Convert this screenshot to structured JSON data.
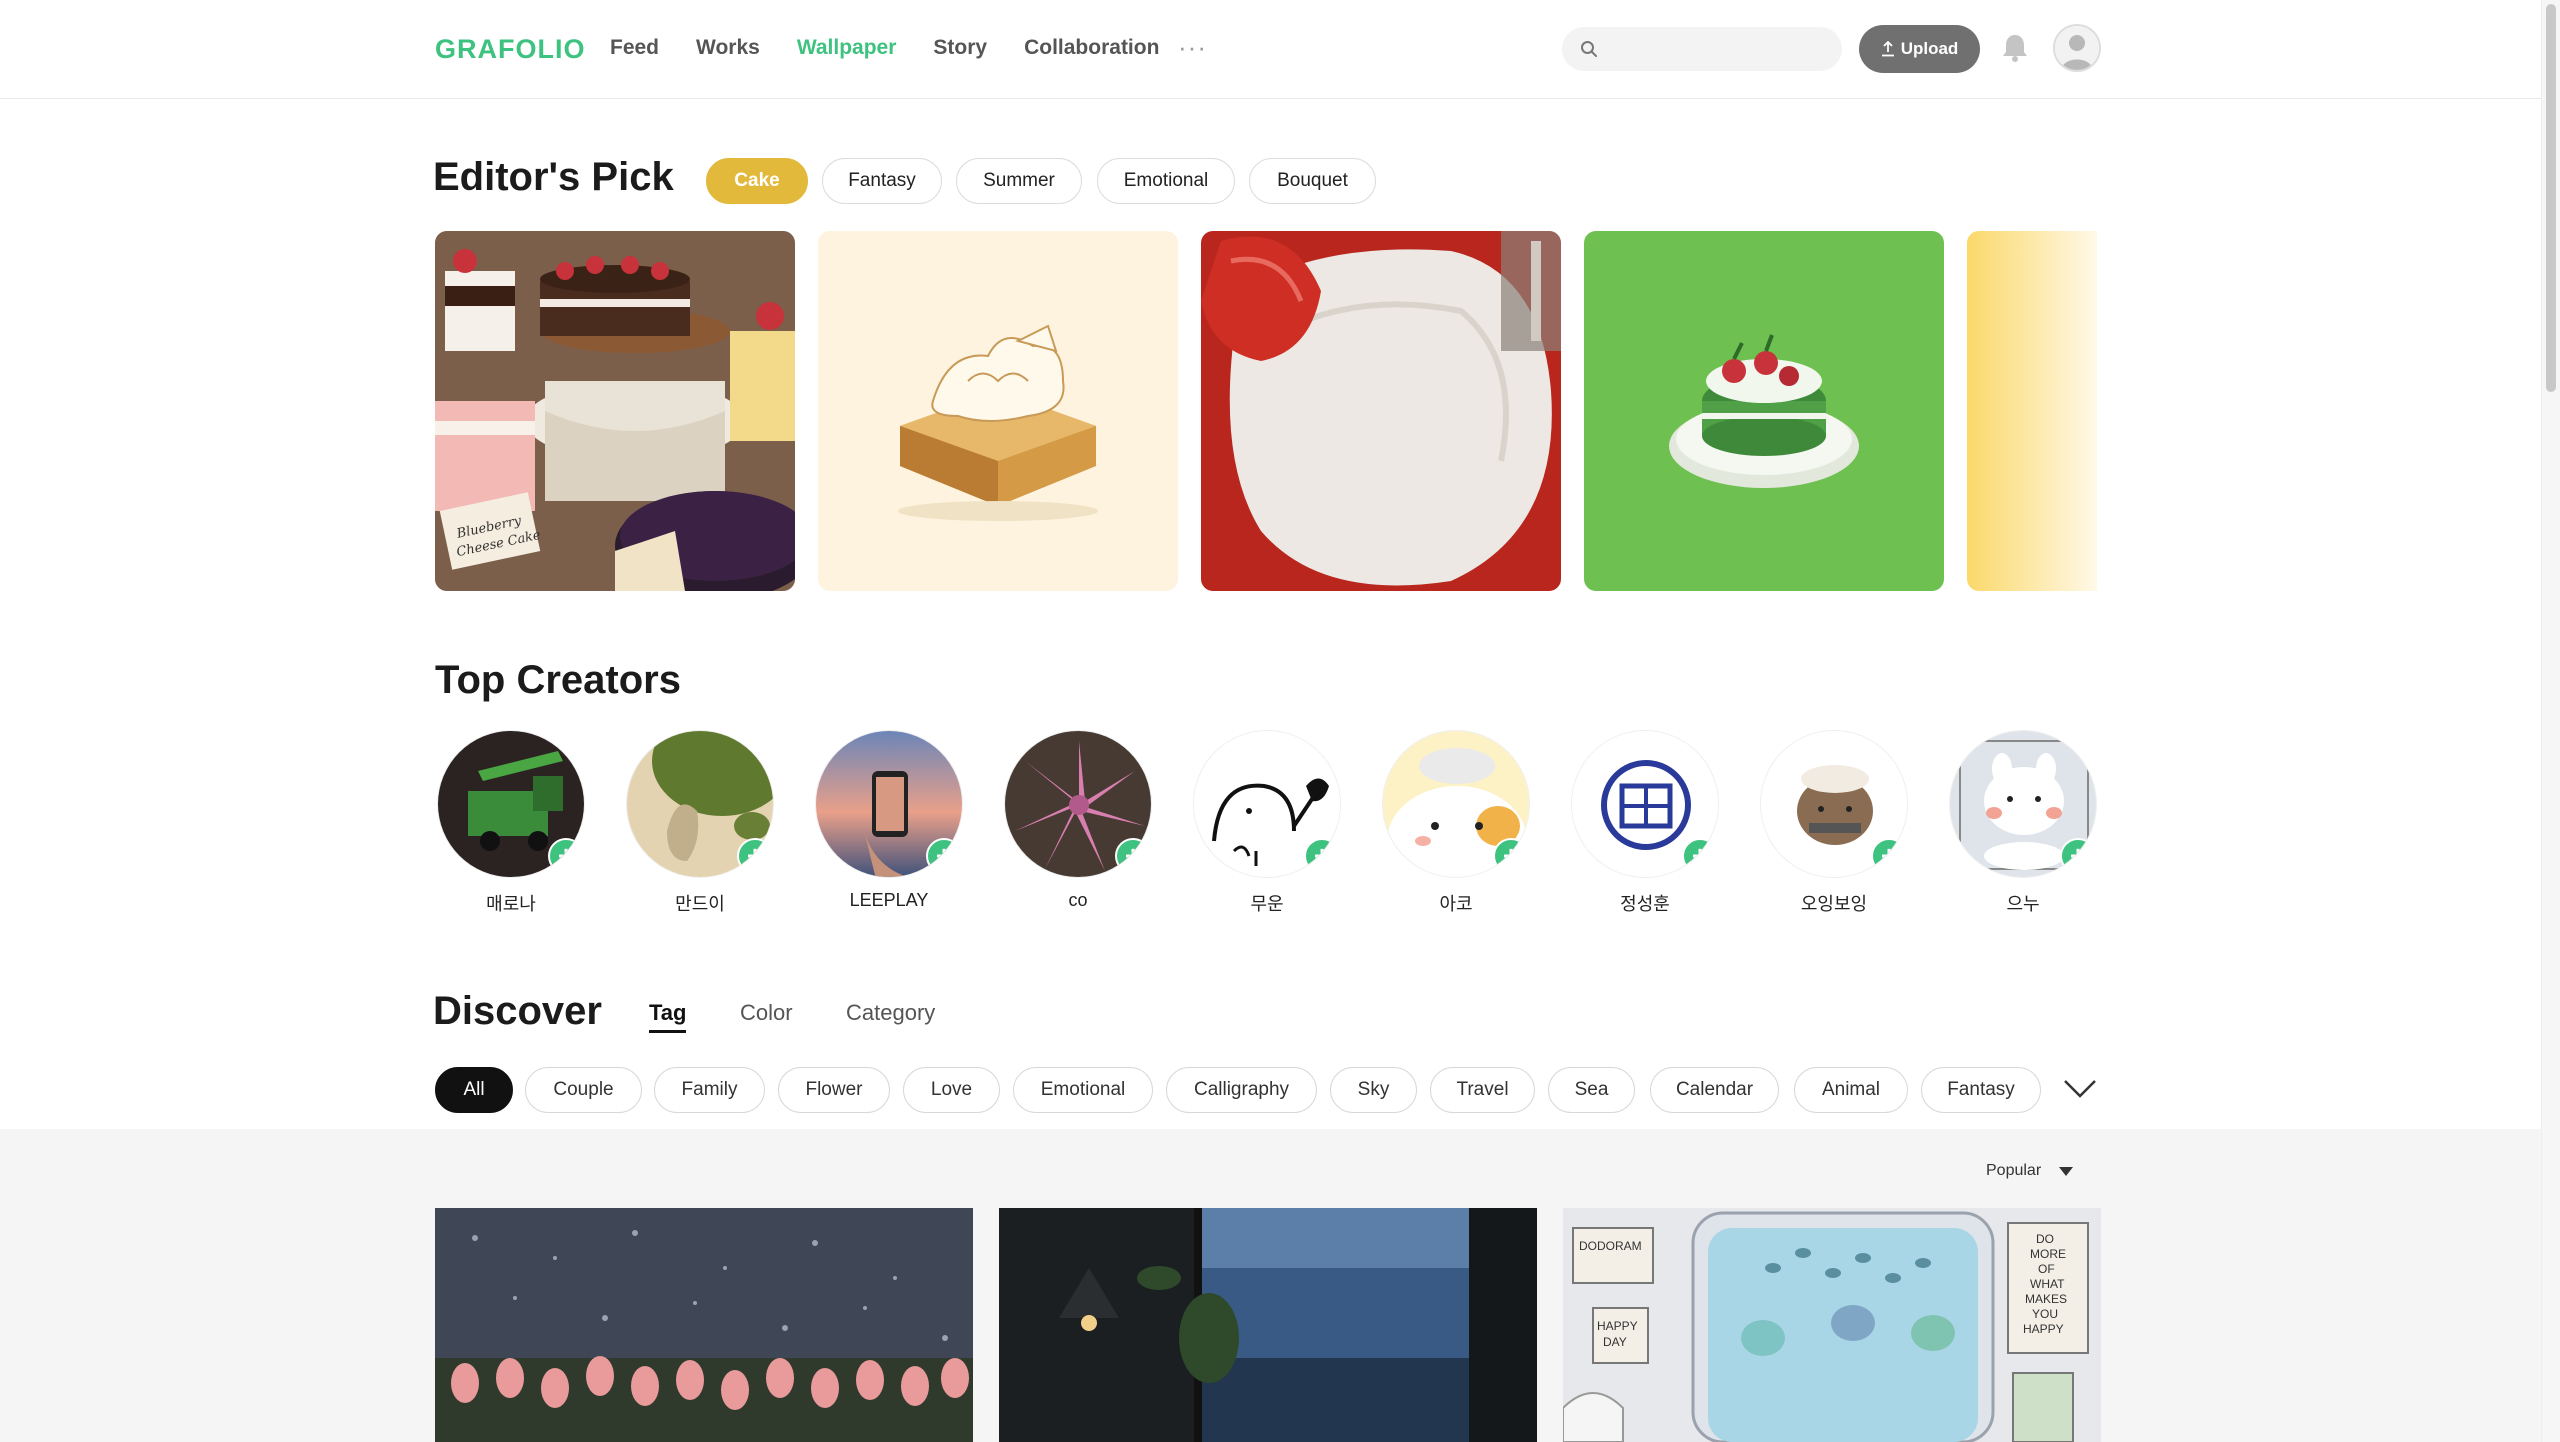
{
  "header": {
    "logo": "GRAFOLIO",
    "nav": [
      "Feed",
      "Works",
      "Wallpaper",
      "Story",
      "Collaboration"
    ],
    "active_nav": "Wallpaper",
    "more_label": "···",
    "search_placeholder": "",
    "upload_label": "Upload",
    "accent_color": "#3ec27f"
  },
  "editors_pick": {
    "title": "Editor's Pick",
    "chips": [
      "Cake",
      "Fantasy",
      "Summer",
      "Emotional",
      "Bouquet"
    ],
    "active_chip": "Cake",
    "active_color": "#e2b93b",
    "cards": [
      "cake-photo",
      "cake-toast-illustration",
      "strawberry-cream-photo",
      "green-cake-illustration",
      "yellow-card"
    ]
  },
  "top_creators": {
    "title": "Top Creators",
    "creators": [
      {
        "name": "매로나"
      },
      {
        "name": "만드이"
      },
      {
        "name": "LEEPLAY"
      },
      {
        "name": "co"
      },
      {
        "name": "무운"
      },
      {
        "name": "아코"
      },
      {
        "name": "정성훈"
      },
      {
        "name": "오잉보잉"
      },
      {
        "name": "으누"
      }
    ]
  },
  "discover": {
    "title": "Discover",
    "tabs": [
      "Tag",
      "Color",
      "Category"
    ],
    "active_tab": "Tag",
    "tags": [
      "All",
      "Couple",
      "Family",
      "Flower",
      "Love",
      "Emotional",
      "Calligraphy",
      "Sky",
      "Travel",
      "Sea",
      "Calendar",
      "Animal",
      "Fantasy"
    ],
    "active_tag": "All",
    "sort_label": "Popular"
  }
}
